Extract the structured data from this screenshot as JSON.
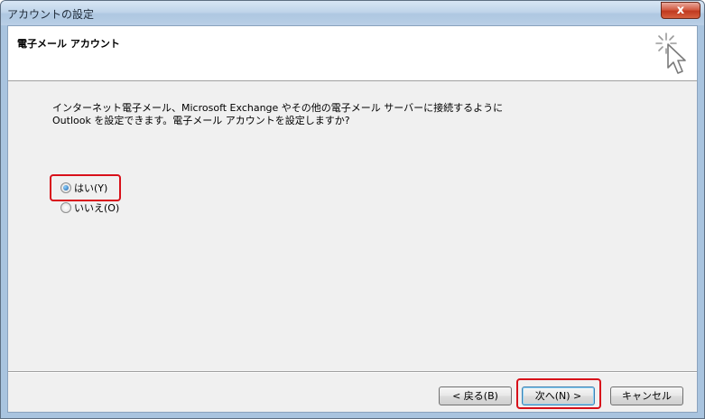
{
  "window": {
    "title": "アカウントの設定",
    "close_label": "x"
  },
  "header": {
    "title": "電子メール アカウント",
    "icon": "wizard-cursor-icon"
  },
  "description": {
    "line1": "インターネット電子メール、Microsoft Exchange やその他の電子メール サーバーに接続するように",
    "line2": "Outlook を設定できます。電子メール アカウントを設定しますか?"
  },
  "options": [
    {
      "label": "はい(Y)",
      "checked": true
    },
    {
      "label": "いいえ(O)",
      "checked": false
    }
  ],
  "buttons": {
    "back": "< 戻る(B)",
    "next": "次へ(N) >",
    "cancel": "キャンセル"
  },
  "colors": {
    "highlight": "#d8101a",
    "dialog_bg": "#f0f0f0"
  }
}
